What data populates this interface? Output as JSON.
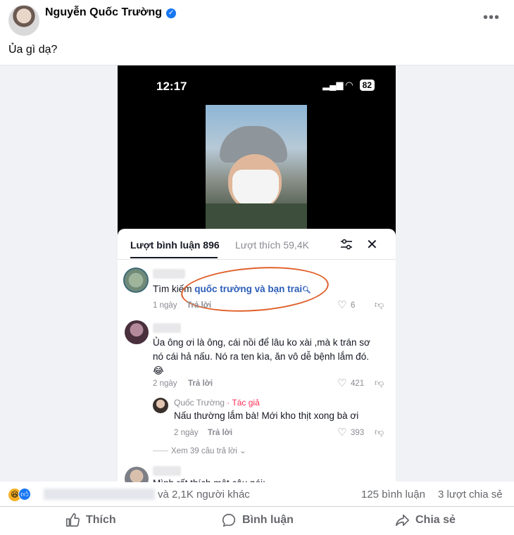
{
  "post": {
    "author": "Nguyễn Quốc Trường",
    "verified_icon": "verified-badge-icon",
    "more_label": "•••",
    "caption": "Ủa gì dạ?"
  },
  "phone": {
    "time": "12:17",
    "battery": "82"
  },
  "sheet": {
    "tab_comments": "Lượt bình luận 896",
    "tab_likes": "Lượt thích 59,4K",
    "close_label": "✕"
  },
  "comments": [
    {
      "prefix": "Tìm kiếm",
      "search_text": "quốc trường và bạn trai",
      "time": "1 ngày",
      "reply": "Trả lời",
      "likes": "6"
    },
    {
      "line1": "Ủa ông ơi là ông, cái nồi để lâu ko xài ,mà k trán sơ",
      "line2": "nó cái hả nấu. Nó ra ten kìa, ăn vô dễ bệnh lắm đó.",
      "emoji": "😂",
      "time": "2 ngày",
      "reply": "Trả lời",
      "likes": "421"
    },
    {
      "name": "Quốc Trường",
      "tag": "· Tác giả",
      "text": "Nấu thường lắm bà! Mới kho thịt xong bà ơi",
      "time": "2 ngày",
      "reply": "Trả lời",
      "likes": "393"
    }
  ],
  "view_replies": "Xem 39 câu trả lời",
  "partial_comment": "Mình rất thích một câu nói:",
  "footer": {
    "reactors_text": "và 2,1K người khác",
    "comments_count": "125 bình luận",
    "shares_count": "3 lượt chia sẻ",
    "like_label": "Thích",
    "comment_label": "Bình luận",
    "share_label": "Chia sẻ"
  },
  "colors": {
    "link": "#2b5db9",
    "author_tag": "#fe2c55",
    "circle_mark": "#e0602a",
    "fb_blue": "#1877f2"
  }
}
